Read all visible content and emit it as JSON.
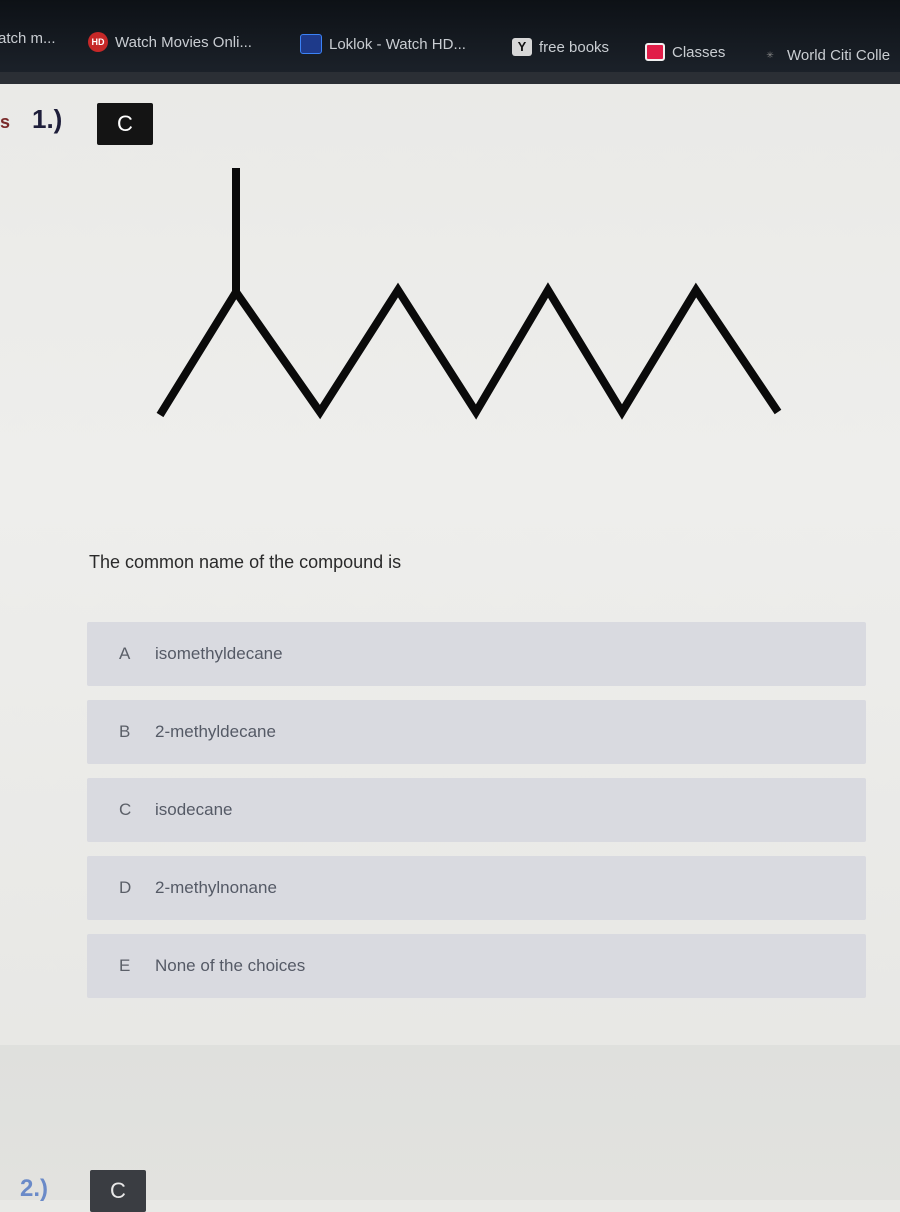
{
  "bookmarks": [
    {
      "label": "atch m...",
      "icon": "none"
    },
    {
      "label": "Watch Movies Onli...",
      "icon": "hd-icon",
      "icon_text": "HD"
    },
    {
      "label": "Loklok - Watch HD...",
      "icon": "loklok-icon"
    },
    {
      "label": "free books",
      "icon": "y-icon",
      "icon_text": "Y"
    },
    {
      "label": "Classes",
      "icon": "classroom-icon"
    },
    {
      "label": "World Citi Colle",
      "icon": "world-citi-icon"
    }
  ],
  "question": {
    "number": "1.)",
    "side_mark": "s",
    "reload_icon": "reload-icon",
    "reload_glyph": "C",
    "prompt": "The common name of the compound is",
    "choices": [
      {
        "letter": "A",
        "text": "isomethyldecane"
      },
      {
        "letter": "B",
        "text": "2-methyldecane"
      },
      {
        "letter": "C",
        "text": "isodecane"
      },
      {
        "letter": "D",
        "text": "2-methylnonane"
      },
      {
        "letter": "E",
        "text": "None of the choices"
      }
    ]
  },
  "next_question": {
    "number": "2.)",
    "reload_glyph": "C"
  },
  "colors": {
    "bookmark_bar": "#141a20",
    "choice_bg": "#d9dae0",
    "reload_bg": "#141414",
    "question_number": "#1e1e3a"
  }
}
